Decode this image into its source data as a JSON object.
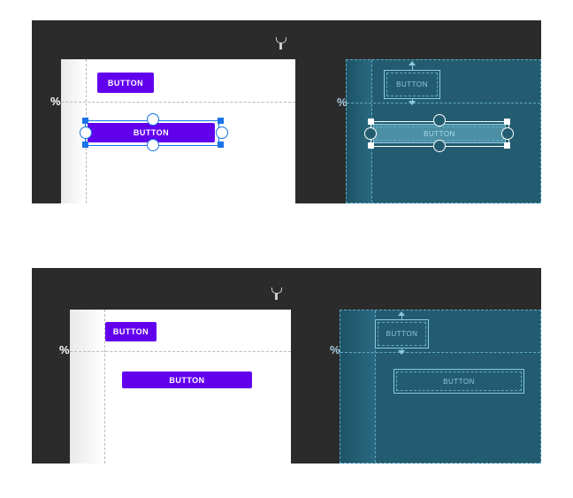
{
  "percent_symbol": "%",
  "button_label": "BUTTON",
  "colors": {
    "editor_background": "#2b2b2b",
    "design_surface": "#ffffff",
    "blueprint_surface": "#235c70",
    "button_fill": "#6200ee",
    "selection": "#1a73e8"
  },
  "icons": [
    "wrench-icon",
    "percent-guideline-icon"
  ],
  "top_example": {
    "design": {
      "button_top": "BUTTON",
      "button_selected": "BUTTON"
    },
    "blueprint": {
      "button_top": "BUTTON",
      "button_selected": "BUTTON"
    }
  },
  "bottom_example": {
    "design": {
      "button_top": "BUTTON",
      "button_bottom": "BUTTON"
    },
    "blueprint": {
      "button_top": "BUTTON",
      "button_bottom": "BUTTON"
    }
  }
}
